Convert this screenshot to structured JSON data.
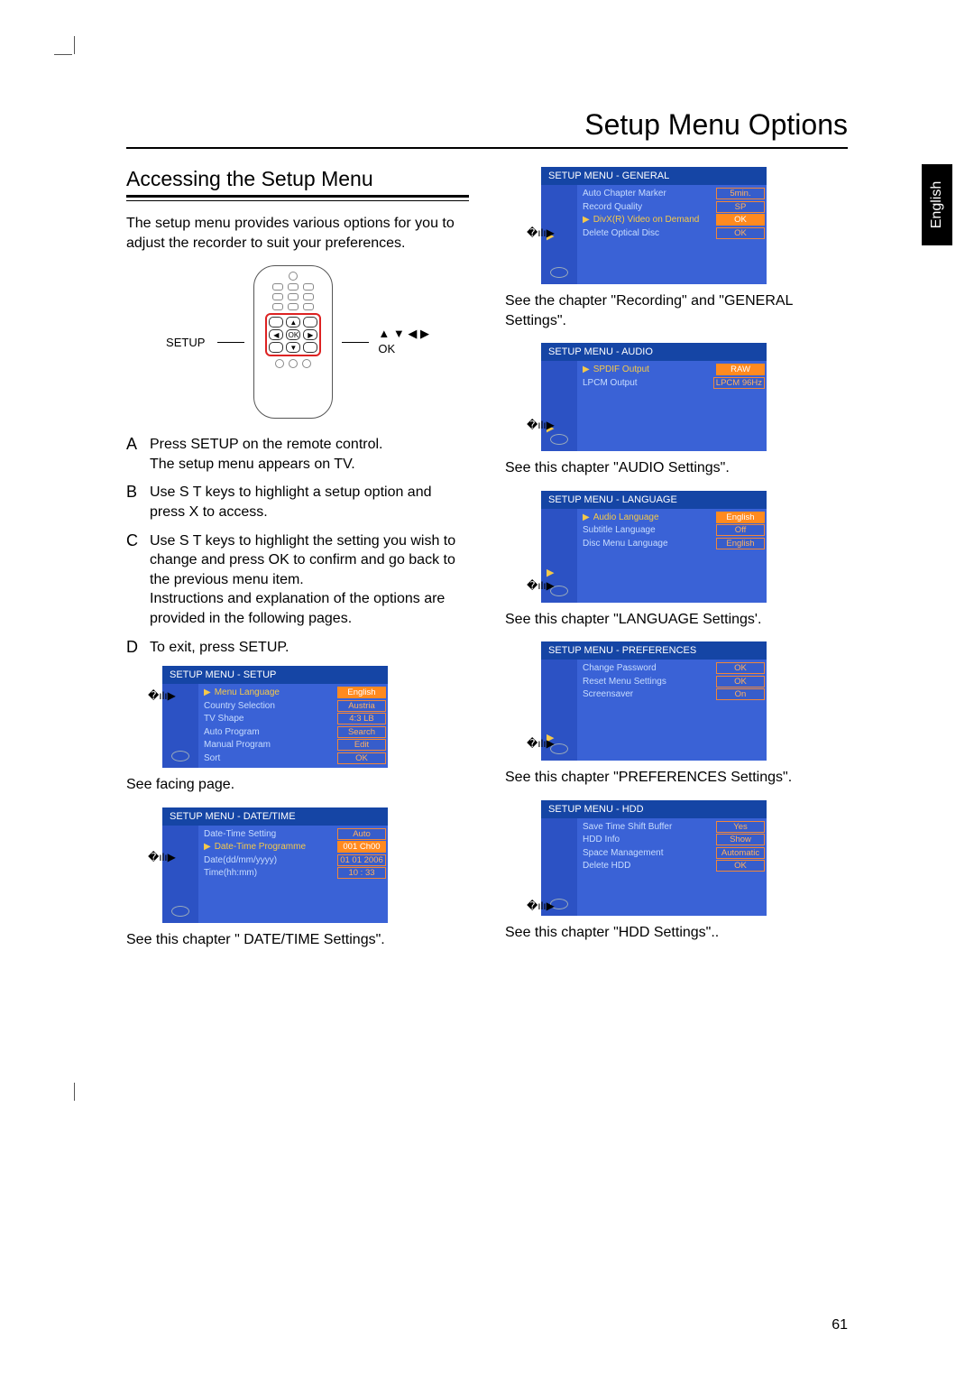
{
  "title": "Setup Menu Options",
  "language_tab": "English",
  "page_number": "61",
  "left": {
    "subheading": "Accessing the Setup Menu",
    "intro": "The setup menu provides various options for you to adjust the recorder to suit your preferences.",
    "remote_left_label": "SETUP",
    "remote_right_top": "▲ ▼ ◀ ▶",
    "remote_right_bottom": "OK",
    "steps": [
      {
        "letter": "A",
        "text": "Press SETUP on the remote control.\n   The setup menu appears on TV."
      },
      {
        "letter": "B",
        "text": "Use  S T  keys to highlight a setup option and press  X to access."
      },
      {
        "letter": "C",
        "text": "Use  S T  keys to highlight the setting you wish to change and press OK  to confirm and go back to the previous menu item.\n   Instructions and explanation of the options are provided in the following pages."
      },
      {
        "letter": "D",
        "text": "To exit, press SETUP."
      }
    ],
    "menu_setup": {
      "title": "SETUP MENU - SETUP",
      "arrow_row": 0,
      "rows": [
        {
          "label": "Menu Language",
          "value": "English",
          "sel": true
        },
        {
          "label": "Country Selection",
          "value": "Austria"
        },
        {
          "label": "TV Shape",
          "value": "4:3 LB"
        },
        {
          "label": "Auto Program",
          "value": "Search"
        },
        {
          "label": "Manual Program",
          "value": "Edit"
        },
        {
          "label": "Sort",
          "value": "OK"
        }
      ]
    },
    "caption_setup": "See facing page.",
    "menu_datetime": {
      "title": "SETUP MENU - DATE/TIME",
      "arrow_row": 1,
      "rows": [
        {
          "label": "Date-Time Setting",
          "value": "Auto"
        },
        {
          "label": "Date-Time Programme",
          "value": "001 Ch00",
          "sel": true
        },
        {
          "label": "Date(dd/mm/yyyy)",
          "value": "01 01 2006"
        },
        {
          "label": "Time(hh:mm)",
          "value": "10 : 33"
        }
      ]
    },
    "caption_datetime": "See this chapter \" DATE/TIME Settings\"."
  },
  "right": {
    "menu_general": {
      "title": "SETUP MENU - GENERAL",
      "arrow_row": 2,
      "rows": [
        {
          "label": "Auto Chapter Marker",
          "value": "5min."
        },
        {
          "label": "Record Quality",
          "value": "SP"
        },
        {
          "label": "DivX(R) Video on Demand",
          "value": "OK",
          "sel": true
        },
        {
          "label": "Delete Optical Disc",
          "value": "OK"
        }
      ]
    },
    "caption_general": "See the chapter \"Recording\" and \"GENERAL Settings\".",
    "menu_audio": {
      "title": "SETUP MENU - AUDIO",
      "arrow_row": 3,
      "rows": [
        {
          "label": "SPDIF Output",
          "value": "RAW",
          "sel": true
        },
        {
          "label": "LPCM Output",
          "value": "LPCM 96Hz"
        }
      ]
    },
    "caption_audio": "See this chapter \"AUDIO Settings\".",
    "menu_language": {
      "title": "SETUP MENU - LANGUAGE",
      "arrow_row": 4,
      "rows": [
        {
          "label": "Audio Language",
          "value": "English",
          "sel": true
        },
        {
          "label": "Subtitle Language",
          "value": "Off"
        },
        {
          "label": "Disc Menu Language",
          "value": "English"
        }
      ]
    },
    "caption_language": "See this chapter \"LANGUAGE Settings'.",
    "menu_preferences": {
      "title": "SETUP MENU - PREFERENCES",
      "arrow_row": 5,
      "rows": [
        {
          "label": "Change Password",
          "value": "OK"
        },
        {
          "label": "Reset Menu Settings",
          "value": "OK"
        },
        {
          "label": "Screensaver",
          "value": "On"
        }
      ]
    },
    "caption_preferences": "See this chapter \"PREFERENCES Settings\".",
    "menu_hdd": {
      "title": "SETUP MENU - HDD",
      "arrow_row": 6,
      "rows": [
        {
          "label": "Save Time Shift Buffer",
          "value": "Yes"
        },
        {
          "label": "HDD Info",
          "value": "Show"
        },
        {
          "label": "Space Management",
          "value": "Automatic"
        },
        {
          "label": "Delete HDD",
          "value": "OK"
        }
      ]
    },
    "caption_hdd": "See this chapter \"HDD Settings\".."
  }
}
